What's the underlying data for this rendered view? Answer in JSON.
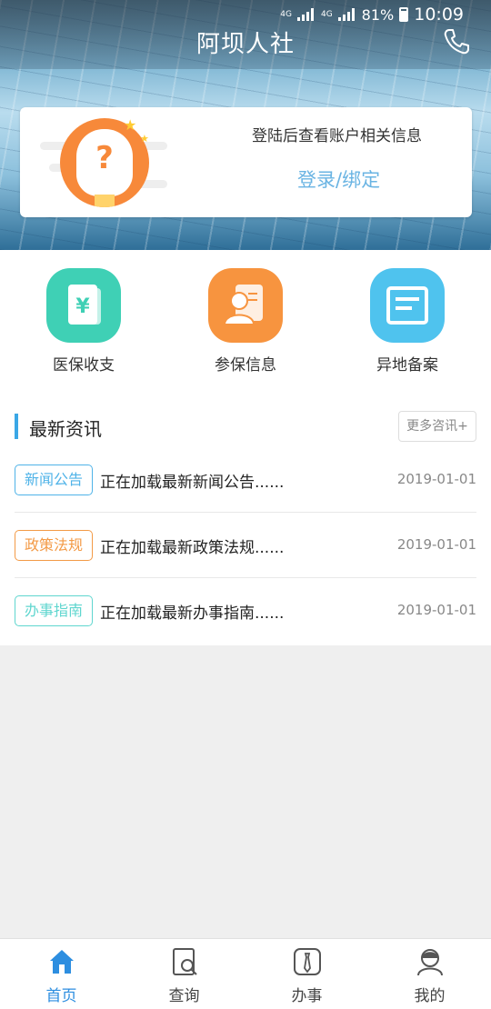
{
  "status_bar": {
    "network_1": "4G",
    "network_2": "4G",
    "battery_percent": "81%",
    "time": "10:09"
  },
  "header": {
    "title": "阿坝人社",
    "phone_icon": "phone-icon"
  },
  "login_card": {
    "hint": "登陆后查看账户相关信息",
    "login_label": "登录/绑定",
    "avatar_icon": "question-avatar-icon"
  },
  "actions": [
    {
      "label": "医保收支",
      "icon": "yuan-document-icon",
      "color": "#3fd0b5"
    },
    {
      "label": "参保信息",
      "icon": "person-card-icon",
      "color": "#f7943f"
    },
    {
      "label": "异地备案",
      "icon": "form-icon",
      "color": "#4fc3ee"
    }
  ],
  "news": {
    "title": "最新资讯",
    "more_label": "更多咨讯+",
    "items": [
      {
        "tag": "新闻公告",
        "text": "正在加载最新新闻公告......",
        "date": "2019-01-01",
        "tag_color": "#4fb3e8"
      },
      {
        "tag": "政策法规",
        "text": "正在加载最新政策法规......",
        "date": "2019-01-01",
        "tag_color": "#f39a46"
      },
      {
        "tag": "办事指南",
        "text": "正在加载最新办事指南......",
        "date": "2019-01-01",
        "tag_color": "#5fd6cf"
      }
    ]
  },
  "bottom_nav": {
    "items": [
      {
        "label": "首页",
        "icon": "home-icon",
        "active": true
      },
      {
        "label": "查询",
        "icon": "search-doc-icon",
        "active": false
      },
      {
        "label": "办事",
        "icon": "tie-icon",
        "active": false
      },
      {
        "label": "我的",
        "icon": "user-icon",
        "active": false
      }
    ],
    "active_color": "#2d8ee0"
  }
}
